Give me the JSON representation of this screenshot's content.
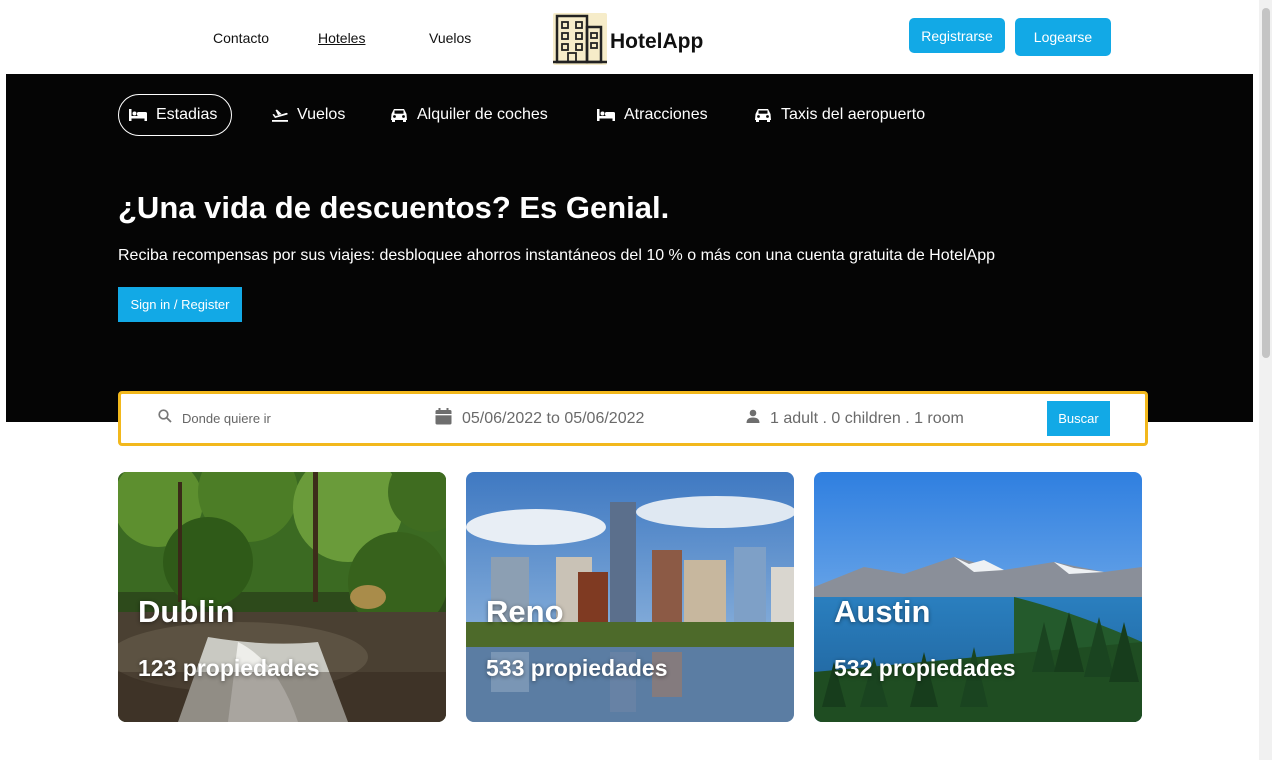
{
  "topnav": {
    "links": [
      "Contacto",
      "Hoteles",
      "Vuelos"
    ],
    "brand": "HotelApp",
    "register_label": "Registrarse",
    "login_label": "Logearse"
  },
  "hero": {
    "tabs": [
      "Estadias",
      "Vuelos",
      "Alquiler de coches",
      "Atracciones",
      "Taxis del aeropuerto"
    ],
    "title": "¿Una vida de descuentos? Es Genial.",
    "subtitle": "Reciba recompensas por sus viajes: desbloquee ahorros instantáneos del 10 % o más con una cuenta gratuita de HotelApp",
    "cta_label": "Sign in / Register"
  },
  "search": {
    "destination_placeholder": "Donde quiere ir",
    "dates": "05/06/2022 to 05/06/2022",
    "guests": "1 adult . 0 children . 1 room",
    "submit_label": "Buscar"
  },
  "destinations": [
    {
      "city": "Dublin",
      "properties": "123 propiedades"
    },
    {
      "city": "Reno",
      "properties": "533 propiedades"
    },
    {
      "city": "Austin",
      "properties": "532 propiedades"
    }
  ],
  "colors": {
    "accent": "#12a9e6",
    "hero_bg": "#050505",
    "search_border": "#f2b81c"
  },
  "icons": [
    "hotel-building-logo",
    "bed-icon",
    "plane-icon",
    "car-icon",
    "search-icon",
    "calendar-icon",
    "person-icon"
  ]
}
